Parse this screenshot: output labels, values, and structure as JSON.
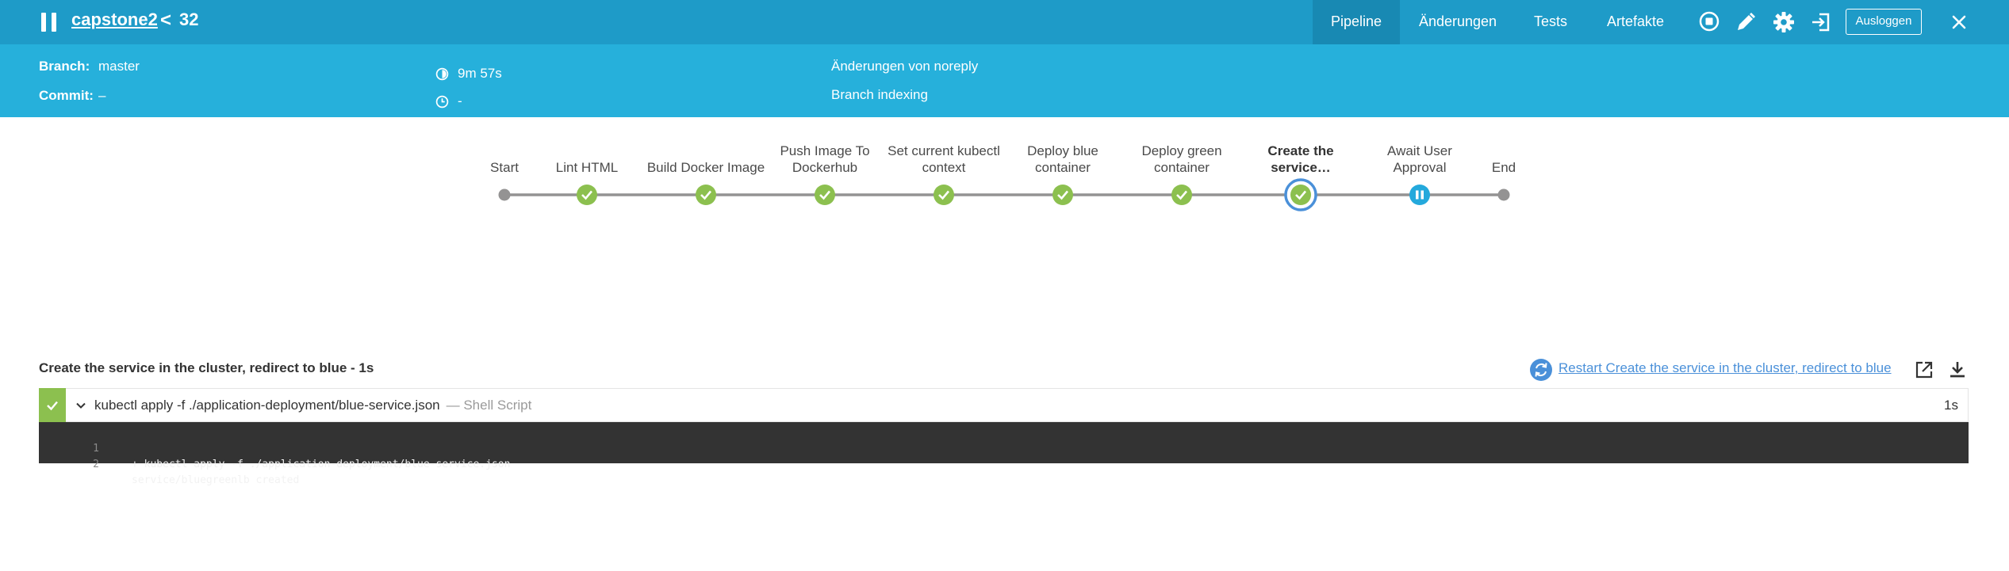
{
  "header": {
    "job_name": "capstone2",
    "back_glyph": "<",
    "run_number": "32",
    "tabs": [
      {
        "label": "Pipeline",
        "active": true
      },
      {
        "label": "Änderungen",
        "active": false
      },
      {
        "label": "Tests",
        "active": false
      },
      {
        "label": "Artefakte",
        "active": false
      }
    ],
    "icons": [
      "stop-icon",
      "edit-icon",
      "gear-icon",
      "sign-in-icon"
    ],
    "logout_label": "Ausloggen",
    "close_icon": "close-icon"
  },
  "run_info": {
    "branch_label": "Branch:",
    "branch_value": "master",
    "commit_label": "Commit:",
    "commit_value": "–",
    "duration": "9m 57s",
    "time": "-",
    "changes": "Änderungen von noreply",
    "cause": "Branch indexing"
  },
  "pipeline": {
    "stages": [
      {
        "label": "Start",
        "status": "start"
      },
      {
        "label": "Lint HTML",
        "status": "success"
      },
      {
        "label": "Build Docker Image",
        "status": "success"
      },
      {
        "label": "Push Image To Dockerhub",
        "status": "success"
      },
      {
        "label": "Set current kubectl context",
        "status": "success"
      },
      {
        "label": "Deploy blue container",
        "status": "success"
      },
      {
        "label": "Deploy green container",
        "status": "success"
      },
      {
        "label": "Create the service…",
        "status": "success",
        "selected": true
      },
      {
        "label": "Await User Approval",
        "status": "paused"
      },
      {
        "label": "End",
        "status": "end"
      }
    ]
  },
  "step": {
    "title": "Create the service in the cluster, redirect to blue - 1s",
    "restart_label": "Restart Create the service in the cluster, redirect to blue",
    "command": "kubectl apply -f ./application-deployment/blue-service.json",
    "type": "— Shell Script",
    "duration": "1s",
    "log": [
      {
        "num": "1",
        "text": "+ kubectl apply -f ./application-deployment/blue-service.json"
      },
      {
        "num": "2",
        "text": "service/bluegreenlb created"
      }
    ]
  },
  "colors": {
    "header": "#1e9bc8",
    "infobar": "#26b0db",
    "success": "#8cc04f",
    "paused": "#24a9dc",
    "connector": "#949393",
    "selected_ring": "#4a90d9",
    "log_bg": "#333333"
  }
}
